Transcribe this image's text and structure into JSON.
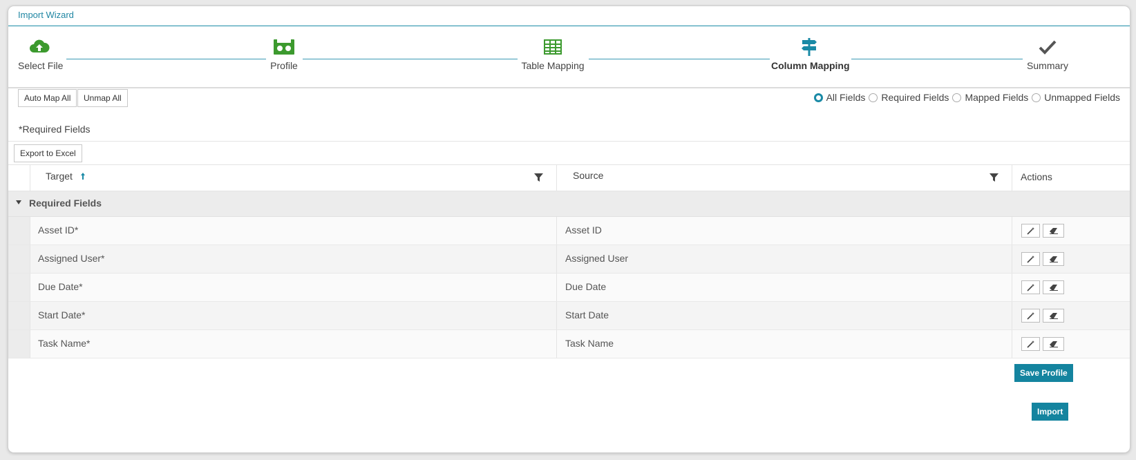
{
  "window": {
    "title": "Import Wizard"
  },
  "steps": [
    {
      "label": "Select File",
      "icon": "cloud-upload-icon",
      "color": "#3c9a2e"
    },
    {
      "label": "Profile",
      "icon": "profile-icon",
      "color": "#3c9a2e"
    },
    {
      "label": "Table Mapping",
      "icon": "table-icon",
      "color": "#3c9a2e"
    },
    {
      "label": "Column Mapping",
      "icon": "signpost-icon",
      "color": "#1a8aa6",
      "active": true
    },
    {
      "label": "Summary",
      "icon": "checkmark-icon",
      "color": "#555555"
    }
  ],
  "toolbar": {
    "auto_map_label": "Auto Map All",
    "unmap_label": "Unmap All",
    "required_note": "*Required Fields",
    "export_label": "Export to Excel"
  },
  "filters": {
    "options": [
      "All Fields",
      "Required Fields",
      "Mapped Fields",
      "Unmapped Fields"
    ],
    "selected": "All Fields"
  },
  "grid": {
    "columns": {
      "target": "Target",
      "source": "Source",
      "actions": "Actions"
    },
    "group_label": "Required Fields",
    "rows": [
      {
        "target": "Asset ID*",
        "source": "Asset ID"
      },
      {
        "target": "Assigned User*",
        "source": "Assigned User"
      },
      {
        "target": "Due Date*",
        "source": "Due Date"
      },
      {
        "target": "Start Date*",
        "source": "Start Date"
      },
      {
        "target": "Task Name*",
        "source": "Task Name"
      }
    ]
  },
  "footer": {
    "save_profile_label": "Save Profile",
    "import_label": "Import"
  },
  "colors": {
    "accent": "#14849f",
    "green": "#3c9a2e"
  }
}
